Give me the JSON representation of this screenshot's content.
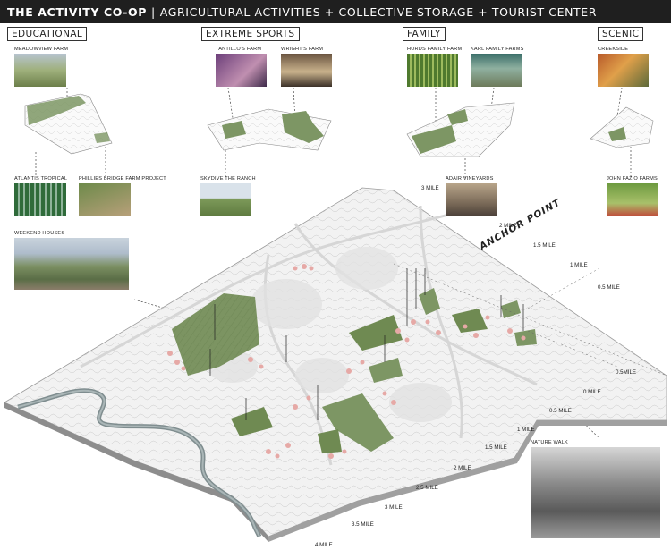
{
  "title": {
    "main": "THE ACTIVITY CO-OP",
    "separator": "|",
    "subtitle": "AGRICULTURAL ACTIVITIES + COLLECTIVE STORAGE + TOURIST CENTER"
  },
  "categories": {
    "educational": "EDUCATIONAL",
    "extreme_sports": "EXTREME SPORTS",
    "family": "FAMILY",
    "scenic": "SCENIC"
  },
  "farms": {
    "meadowview": "MEADOWVIEW FARM",
    "atlantis": "ATLANTIS TROPICAL",
    "phillies": "PHILLIES BRIDGE FARM PROJECT",
    "tantillo": "TANTILLO'S FARM",
    "wrights": "WRIGHT'S FARM",
    "skydive": "SKYDIVE THE RANCH",
    "hurds": "HURDS FAMILY FARM",
    "karl": "KARL FAMILY FARMS",
    "adair": "ADAIR VINEYARDS",
    "creekside": "CREEKSIDE",
    "john_fazio": "JOHN FAZIO FARMS",
    "weekend_houses": "WEEKEND HOUSES",
    "nature_walk": "NATURE WALK"
  },
  "anchor_point": "ANCHOR POINT",
  "distances": {
    "left_scale": [
      "4 MILE",
      "3.5 MILE",
      "3 MILE",
      "2.5 MILE",
      "2 MILE",
      "1.5 MILE",
      "1 MILE",
      "0.5 MILE",
      "0 MILE"
    ],
    "right_scale": [
      "0.5MILE",
      "0.5 MILE",
      "1 MILE",
      "1.5 MILE",
      "2 MILE",
      "3 MILE"
    ]
  },
  "colors": {
    "title_bar": "#1f1f1f",
    "farm_green": "#6f8a52",
    "terrain": "#ececec",
    "river": "#7f8d8f",
    "blossom": "#e6a9a6"
  }
}
